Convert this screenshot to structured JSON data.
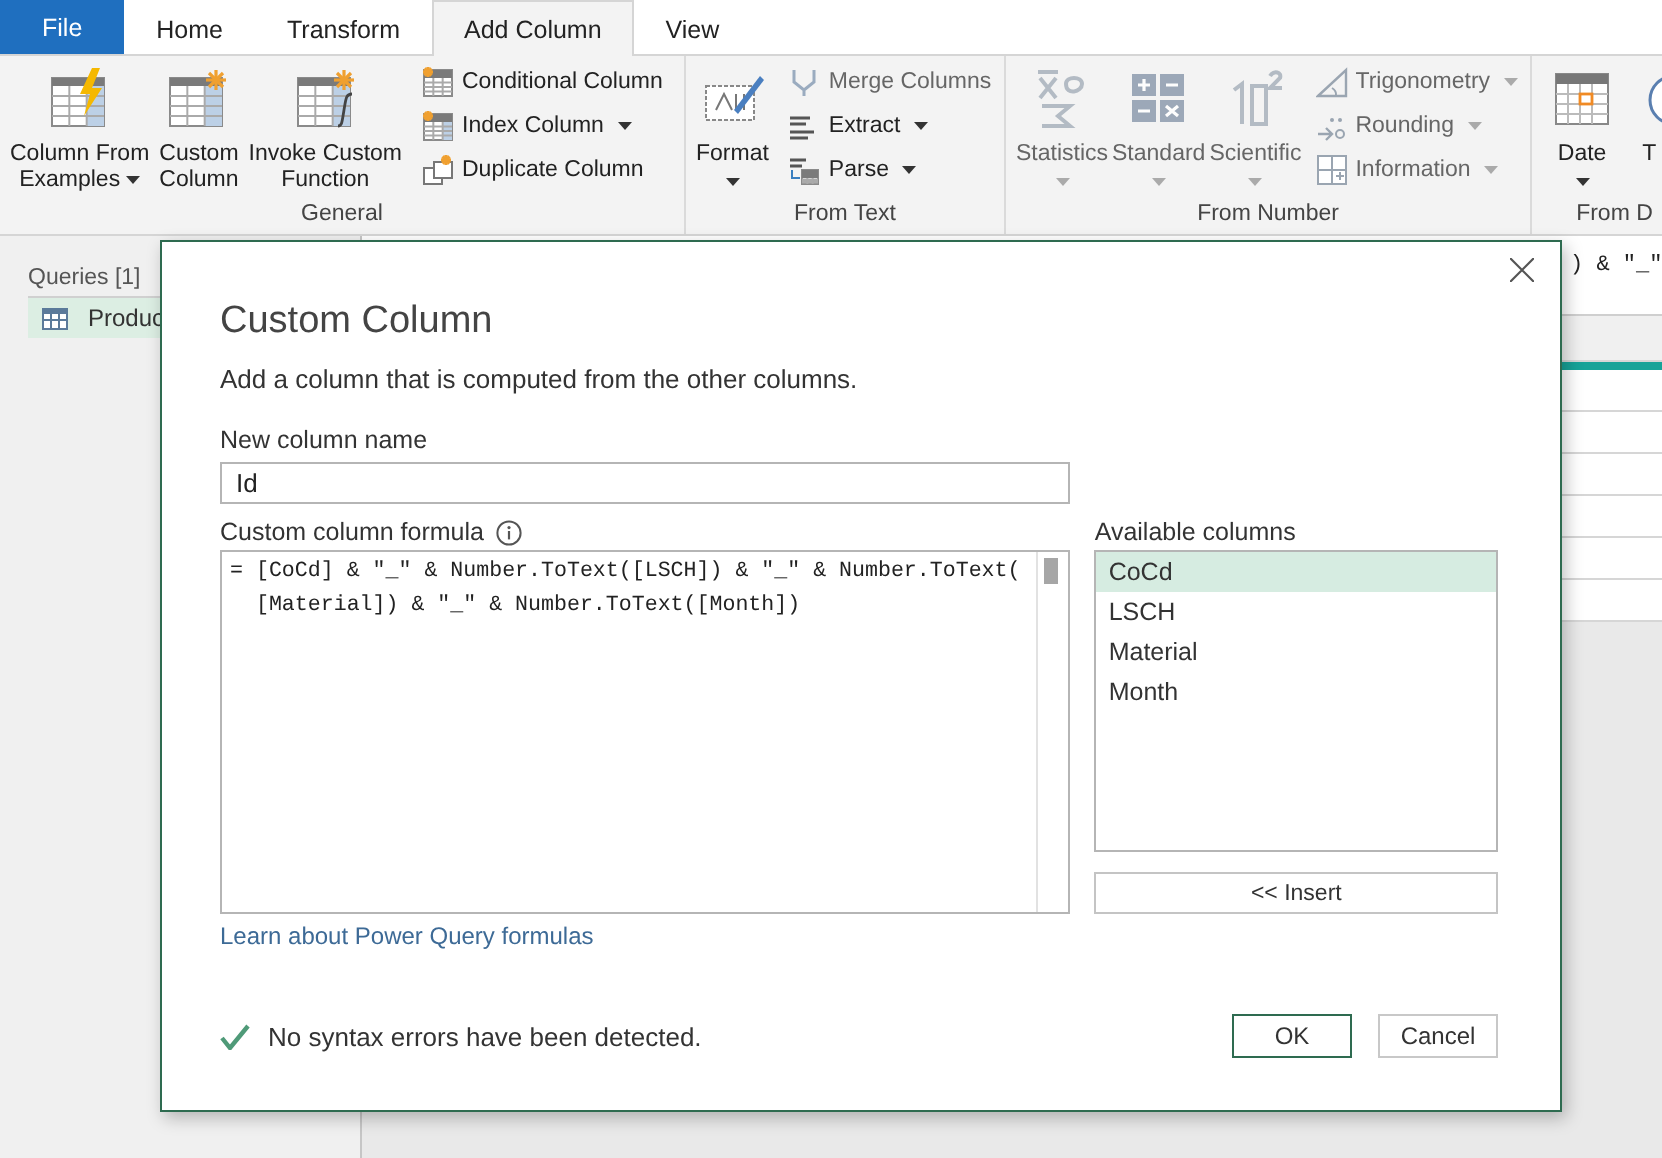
{
  "tabs": [
    {
      "label": "File",
      "kind": "file",
      "selected": false
    },
    {
      "label": "Home",
      "kind": "tab",
      "selected": false
    },
    {
      "label": "Transform",
      "kind": "tab",
      "selected": false
    },
    {
      "label": "Add Column",
      "kind": "tab",
      "selected": true
    },
    {
      "label": "View",
      "kind": "tab",
      "selected": false
    }
  ],
  "ribbon_groups": [
    {
      "label": "General",
      "items": [
        {
          "kind": "large",
          "lines": [
            "Column From",
            "Examples"
          ],
          "dropdown": true,
          "disabled": false
        },
        {
          "kind": "large",
          "lines": [
            "Custom",
            "Column"
          ],
          "dropdown": false,
          "disabled": false
        },
        {
          "kind": "large",
          "lines": [
            "Invoke Custom",
            "Function"
          ],
          "dropdown": false,
          "disabled": false
        },
        {
          "kind": "small",
          "label": "Conditional Column",
          "dropdown": false,
          "disabled": false
        },
        {
          "kind": "small",
          "label": "Index Column",
          "dropdown": true,
          "disabled": false
        },
        {
          "kind": "small",
          "label": "Duplicate Column",
          "dropdown": false,
          "disabled": false
        }
      ]
    },
    {
      "label": "From Text",
      "items": [
        {
          "kind": "large",
          "lines": [
            "Format"
          ],
          "dropdown": true,
          "disabled": false
        },
        {
          "kind": "small",
          "label": "Merge Columns",
          "dropdown": false,
          "disabled": true
        },
        {
          "kind": "small",
          "label": "Extract",
          "dropdown": true,
          "disabled": false
        },
        {
          "kind": "small",
          "label": "Parse",
          "dropdown": true,
          "disabled": false
        }
      ]
    },
    {
      "label": "From Number",
      "items": [
        {
          "kind": "large",
          "lines": [
            "Statistics"
          ],
          "dropdown": true,
          "disabled": true
        },
        {
          "kind": "large",
          "lines": [
            "Standard"
          ],
          "dropdown": true,
          "disabled": true
        },
        {
          "kind": "large",
          "lines": [
            "Scientific"
          ],
          "dropdown": true,
          "disabled": true
        },
        {
          "kind": "small",
          "label": "Trigonometry",
          "dropdown": true,
          "disabled": true
        },
        {
          "kind": "small",
          "label": "Rounding",
          "dropdown": true,
          "disabled": true
        },
        {
          "kind": "small",
          "label": "Information",
          "dropdown": true,
          "disabled": true
        }
      ]
    },
    {
      "label": "From D",
      "items": [
        {
          "kind": "large",
          "lines": [
            "Date"
          ],
          "dropdown": true,
          "disabled": false
        },
        {
          "kind": "large",
          "lines": [
            "T"
          ],
          "dropdown": false,
          "disabled": false
        }
      ]
    }
  ],
  "queries_pane": {
    "heading": "Queries [1]",
    "items": [
      {
        "label": "Produc",
        "selected": true
      }
    ]
  },
  "formula_bar": {
    "text": ") & \"_\""
  },
  "dialog": {
    "title": "Custom Column",
    "description": "Add a column that is computed from the other columns.",
    "name_label": "New column name",
    "name_value": "Id",
    "formula_label": "Custom column formula",
    "formula_lines": [
      "= [CoCd] & \"_\" & Number.ToText([LSCH]) & \"_\" & Number.ToText(",
      "  [Material]) & \"_\" & Number.ToText([Month])"
    ],
    "columns_label": "Available columns",
    "columns": [
      {
        "label": "CoCd",
        "selected": true
      },
      {
        "label": "LSCH",
        "selected": false
      },
      {
        "label": "Material",
        "selected": false
      },
      {
        "label": "Month",
        "selected": false
      }
    ],
    "insert_button": "<< Insert",
    "help_link": "Learn about Power Query formulas",
    "status": "No syntax errors have been detected.",
    "buttons": [
      {
        "label": "OK",
        "kind": "primary"
      },
      {
        "label": "Cancel",
        "kind": "secondary"
      }
    ]
  }
}
